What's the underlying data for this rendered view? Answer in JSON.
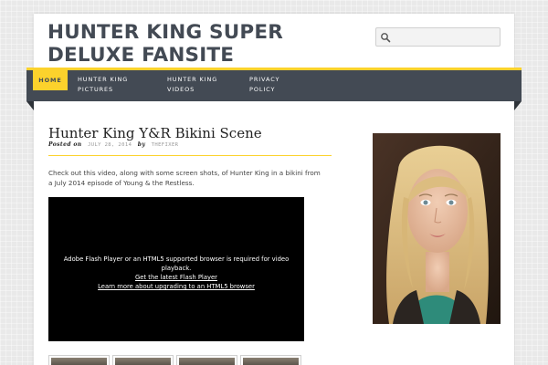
{
  "site": {
    "title": "HUNTER KING SUPER DELUXE FANSITE"
  },
  "search": {
    "placeholder": "",
    "value": ""
  },
  "nav": {
    "items": [
      {
        "label": "HOME",
        "active": true
      },
      {
        "label": "HUNTER KING PICTURES",
        "active": false
      },
      {
        "label": "HUNTER KING VIDEOS",
        "active": false
      },
      {
        "label": "PRIVACY POLICY",
        "active": false
      }
    ]
  },
  "post": {
    "title": "Hunter King Y&R Bikini Scene",
    "posted_on_label": "Posted on",
    "date": "JULY 28, 2014",
    "by_label": "by",
    "author": "THEFIXER",
    "excerpt": "Check out this video, along with some screen shots, of Hunter King in a bikini from a July 2014 episode of Young & the Restless."
  },
  "video": {
    "message": "Adobe Flash Player or an HTML5 supported browser is required for video playback.",
    "link_flash": "Get the latest Flash Player",
    "link_html5": "Learn more about upgrading to an HTML5 browser"
  },
  "thumbnails": {
    "count": 4
  },
  "colors": {
    "accent": "#fcd22c",
    "nav_bg": "#434a54",
    "title_text": "#434a54"
  },
  "icons": {
    "search": "search-icon"
  }
}
